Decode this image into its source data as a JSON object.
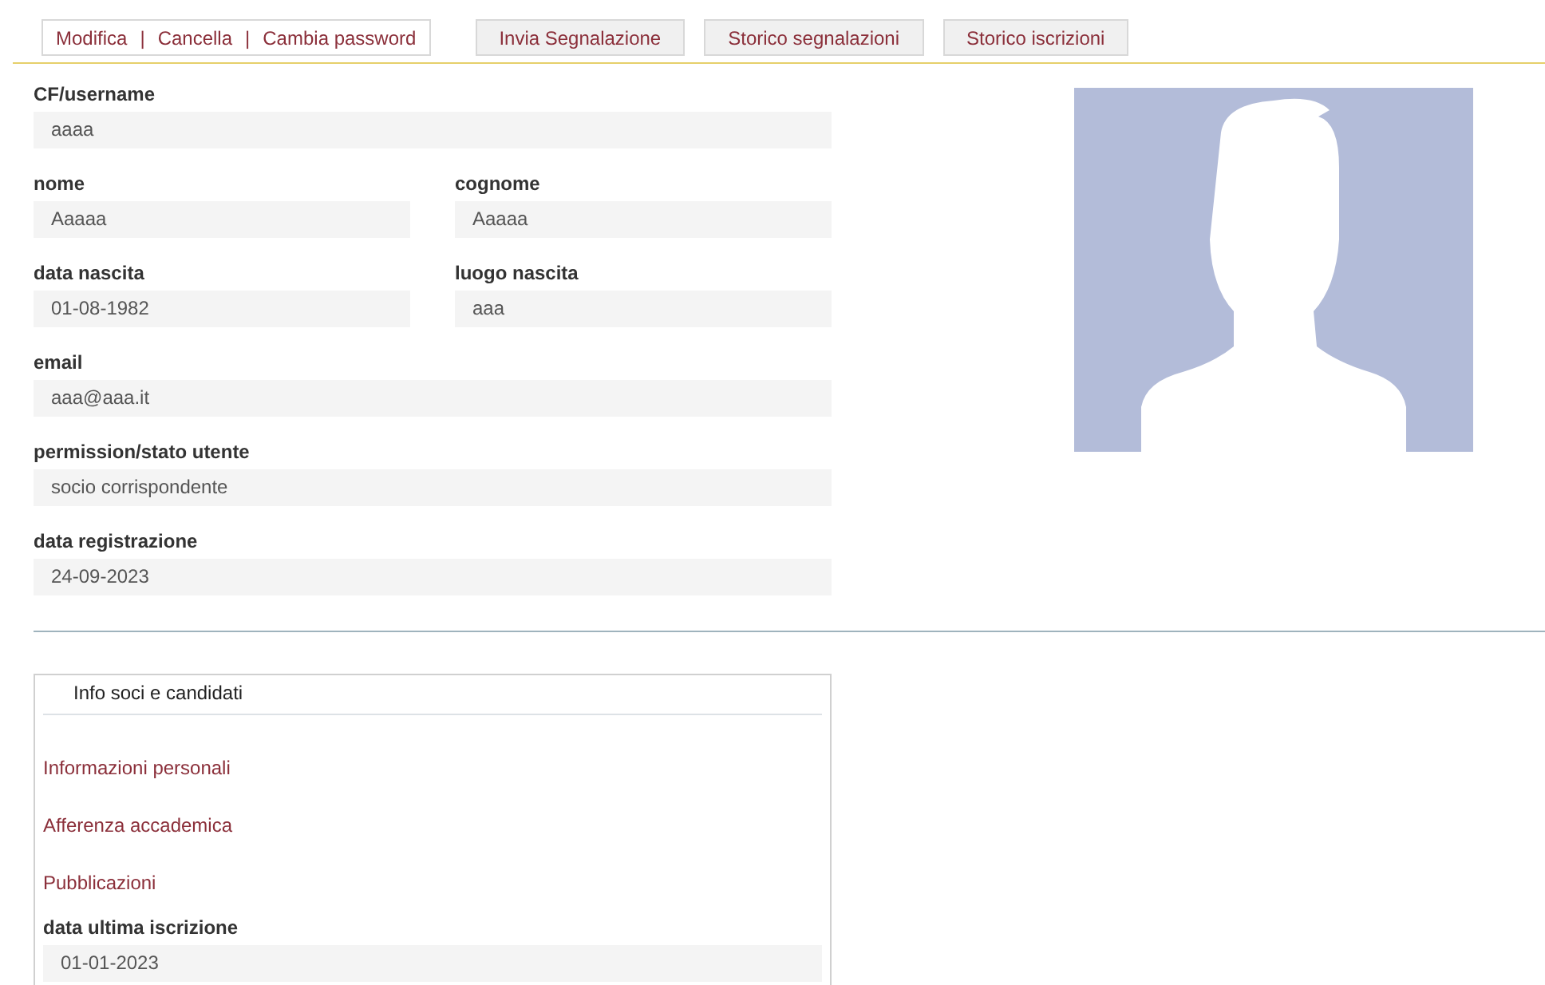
{
  "toolbar": {
    "links": [
      "Modifica",
      "Cancella",
      "Cambia password"
    ],
    "separator": "|",
    "buttons": [
      "Invia Segnalazione",
      "Storico segnalazioni",
      "Storico iscrizioni"
    ]
  },
  "fields": [
    {
      "label": "CF/username",
      "value": "aaaa",
      "kind": "full"
    },
    {
      "label": "nome",
      "value": "Aaaaa",
      "kind": "half"
    },
    {
      "label": "cognome",
      "value": "Aaaaa",
      "kind": "half"
    },
    {
      "label": "data nascita",
      "value": "01-08-1982",
      "kind": "half"
    },
    {
      "label": "luogo nascita",
      "value": "aaa",
      "kind": "half"
    },
    {
      "label": "email",
      "value": "aaa@aaa.it",
      "kind": "full"
    },
    {
      "label": "permission/stato utente",
      "value": "socio corrispondente",
      "kind": "full"
    },
    {
      "label": "data registrazione",
      "value": "24-09-2023",
      "kind": "full"
    }
  ],
  "info_box": {
    "legend": "Info soci e candidati",
    "links": [
      "Informazioni personali",
      "Afferenza accademica",
      "Pubblicazioni"
    ],
    "field": {
      "label": "data ultima iscrizione",
      "value": "01-01-2023"
    }
  }
}
